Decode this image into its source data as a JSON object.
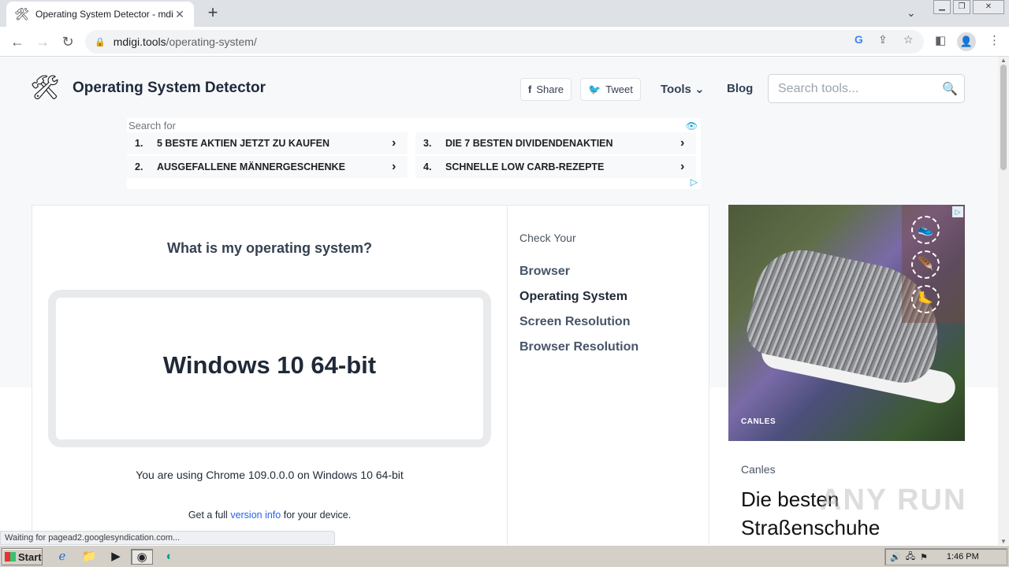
{
  "browser": {
    "tab_title": "Operating System Detector - mdigi.t",
    "tab_favicon": "🛠",
    "url_host": "mdigi.tools",
    "url_path": "/operating-system/",
    "status_text": "Waiting for pagead2.googlesyndication.com..."
  },
  "site": {
    "title": "Operating System Detector",
    "share_label": "Share",
    "tweet_label": "Tweet",
    "nav_tools": "Tools",
    "nav_blog": "Blog",
    "search_placeholder": "Search tools..."
  },
  "top_ad": {
    "heading": "Search for",
    "items": [
      {
        "num": "1.",
        "label": "5 BESTE AKTIEN JETZT ZU KAUFEN"
      },
      {
        "num": "3.",
        "label": "DIE 7 BESTEN DIVIDENDENAKTIEN"
      },
      {
        "num": "2.",
        "label": "AUSGEFALLENE MÄNNERGESCHENKE"
      },
      {
        "num": "4.",
        "label": "SCHNELLE LOW CARB-REZEPTE"
      }
    ]
  },
  "main": {
    "question": "What is my operating system?",
    "result": "Windows 10 64-bit",
    "using_text": "You are using Chrome 109.0.0.0 on Windows 10 64-bit",
    "full_info_prefix": "Get a full ",
    "full_info_link": "version info",
    "full_info_suffix": " for your device."
  },
  "sidebar": {
    "heading": "Check Your",
    "links": [
      "Browser",
      "Operating System",
      "Screen Resolution",
      "Browser Resolution"
    ]
  },
  "right_ad": {
    "logo_text": "CANLES",
    "brand": "Canles",
    "headline": "Die besten Straßenschuhe"
  },
  "watermark": "ANY RUN",
  "taskbar": {
    "start_label": "Start",
    "clock": "1:46 PM"
  }
}
